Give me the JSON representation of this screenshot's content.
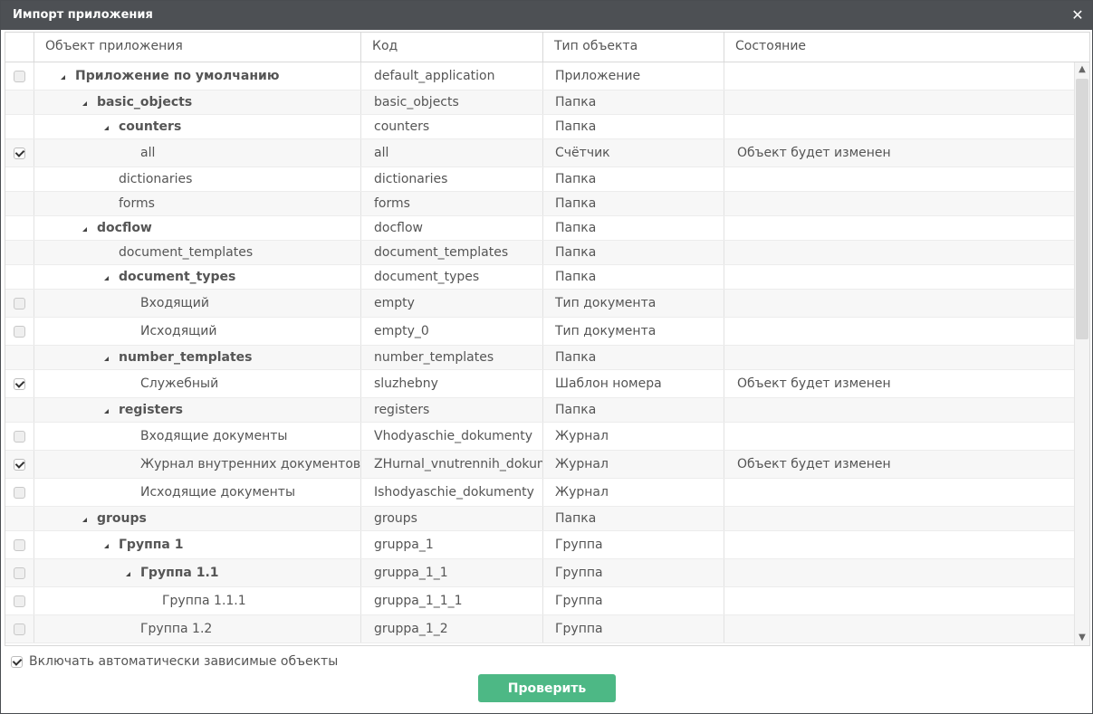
{
  "dialog": {
    "title": "Импорт приложения",
    "close_icon": "close-icon"
  },
  "columns": [
    "Объект приложения",
    "Код",
    "Тип объекта",
    "Состояние"
  ],
  "rows": [
    {
      "checkbox": "off",
      "depth": 0,
      "expand": true,
      "bold": true,
      "name": "Приложение по умолчанию",
      "code": "default_application",
      "type": "Приложение",
      "state": ""
    },
    {
      "checkbox": "none",
      "depth": 1,
      "expand": true,
      "bold": true,
      "name": "basic_objects",
      "code": "basic_objects",
      "type": "Папка",
      "state": ""
    },
    {
      "checkbox": "none",
      "depth": 2,
      "expand": true,
      "bold": true,
      "name": "counters",
      "code": "counters",
      "type": "Папка",
      "state": ""
    },
    {
      "checkbox": "on",
      "depth": 3,
      "expand": false,
      "bold": false,
      "name": "all",
      "code": "all",
      "type": "Счётчик",
      "state": "Объект будет изменен"
    },
    {
      "checkbox": "none",
      "depth": 2,
      "expand": false,
      "bold": false,
      "name": "dictionaries",
      "code": "dictionaries",
      "type": "Папка",
      "state": ""
    },
    {
      "checkbox": "none",
      "depth": 2,
      "expand": false,
      "bold": false,
      "name": "forms",
      "code": "forms",
      "type": "Папка",
      "state": ""
    },
    {
      "checkbox": "none",
      "depth": 1,
      "expand": true,
      "bold": true,
      "name": "docflow",
      "code": "docflow",
      "type": "Папка",
      "state": ""
    },
    {
      "checkbox": "none",
      "depth": 2,
      "expand": false,
      "bold": false,
      "name": "document_templates",
      "code": "document_templates",
      "type": "Папка",
      "state": ""
    },
    {
      "checkbox": "none",
      "depth": 2,
      "expand": true,
      "bold": true,
      "name": "document_types",
      "code": "document_types",
      "type": "Папка",
      "state": ""
    },
    {
      "checkbox": "off",
      "depth": 3,
      "expand": false,
      "bold": false,
      "name": "Входящий",
      "code": "empty",
      "type": "Тип документа",
      "state": ""
    },
    {
      "checkbox": "off",
      "depth": 3,
      "expand": false,
      "bold": false,
      "name": "Исходящий",
      "code": "empty_0",
      "type": "Тип документа",
      "state": ""
    },
    {
      "checkbox": "none",
      "depth": 2,
      "expand": true,
      "bold": true,
      "name": "number_templates",
      "code": "number_templates",
      "type": "Папка",
      "state": ""
    },
    {
      "checkbox": "on",
      "depth": 3,
      "expand": false,
      "bold": false,
      "name": "Служебный",
      "code": "sluzhebny",
      "type": "Шаблон номера",
      "state": "Объект будет изменен"
    },
    {
      "checkbox": "none",
      "depth": 2,
      "expand": true,
      "bold": true,
      "name": "registers",
      "code": "registers",
      "type": "Папка",
      "state": ""
    },
    {
      "checkbox": "off",
      "depth": 3,
      "expand": false,
      "bold": false,
      "name": "Входящие документы",
      "code": "Vhodyaschie_dokumenty",
      "type": "Журнал",
      "state": ""
    },
    {
      "checkbox": "on",
      "depth": 3,
      "expand": false,
      "bold": false,
      "name": "Журнал внутренних документов",
      "code": "ZHurnal_vnutrennih_dokume",
      "type": "Журнал",
      "state": "Объект будет изменен"
    },
    {
      "checkbox": "off",
      "depth": 3,
      "expand": false,
      "bold": false,
      "name": "Исходящие документы",
      "code": "Ishodyaschie_dokumenty",
      "type": "Журнал",
      "state": ""
    },
    {
      "checkbox": "none",
      "depth": 1,
      "expand": true,
      "bold": true,
      "name": "groups",
      "code": "groups",
      "type": "Папка",
      "state": ""
    },
    {
      "checkbox": "off",
      "depth": 2,
      "expand": true,
      "bold": true,
      "name": "Группа 1",
      "code": "gruppa_1",
      "type": "Группа",
      "state": ""
    },
    {
      "checkbox": "off",
      "depth": 3,
      "expand": true,
      "bold": true,
      "name": "Группа 1.1",
      "code": "gruppa_1_1",
      "type": "Группа",
      "state": ""
    },
    {
      "checkbox": "off",
      "depth": 4,
      "expand": false,
      "bold": false,
      "name": "Группа 1.1.1",
      "code": "gruppa_1_1_1",
      "type": "Группа",
      "state": ""
    },
    {
      "checkbox": "off",
      "depth": 3,
      "expand": false,
      "bold": false,
      "name": "Группа 1.2",
      "code": "gruppa_1_2",
      "type": "Группа",
      "state": ""
    }
  ],
  "footer": {
    "auto_include_label": "Включать автоматически зависимые объекты",
    "auto_include_checked": true,
    "check_button_label": "Проверить"
  },
  "icons": {
    "expand": "expanded-triangle-icon",
    "scroll_up": "scroll-up-icon",
    "scroll_down": "scroll-down-icon"
  }
}
